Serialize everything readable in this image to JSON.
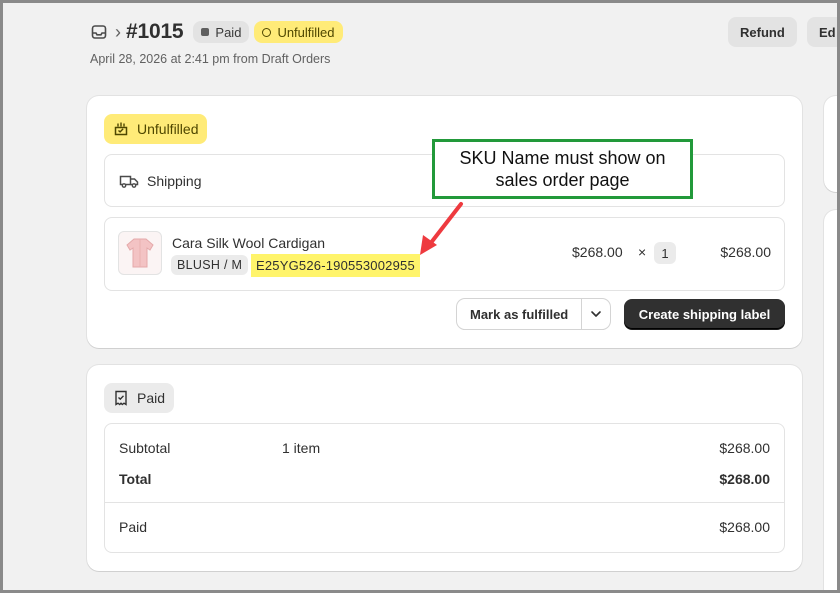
{
  "header": {
    "order_number": "#1015",
    "payment_badge": "Paid",
    "fulfillment_badge": "Unfulfilled",
    "subline": "April 28, 2026 at 2:41 pm from Draft Orders",
    "refund_label": "Refund",
    "edit_label": "Ed"
  },
  "fulfillment_card": {
    "status_label": "Unfulfilled",
    "shipping_label": "Shipping",
    "item": {
      "name": "Cara Silk Wool Cardigan",
      "variant": "BLUSH / M",
      "sku": "E25YG526-190553002955",
      "unit_price": "$268.00",
      "times": "×",
      "quantity": "1",
      "total": "$268.00"
    },
    "mark_fulfilled_label": "Mark as fulfilled",
    "create_label_button": "Create shipping label"
  },
  "payment_card": {
    "status_label": "Paid",
    "subtotal_label": "Subtotal",
    "subtotal_items": "1 item",
    "subtotal_amount": "$268.00",
    "total_label": "Total",
    "total_amount": "$268.00",
    "paid_label": "Paid",
    "paid_amount": "$268.00"
  },
  "annotation": {
    "text": "SKU Name must show on sales order page"
  },
  "colors": {
    "unfulfilled_bg": "#ffeb78",
    "sku_highlight": "#fff46b",
    "callout_border": "#22993a",
    "arrow": "#ee3a3f",
    "primary_button": "#303030"
  }
}
